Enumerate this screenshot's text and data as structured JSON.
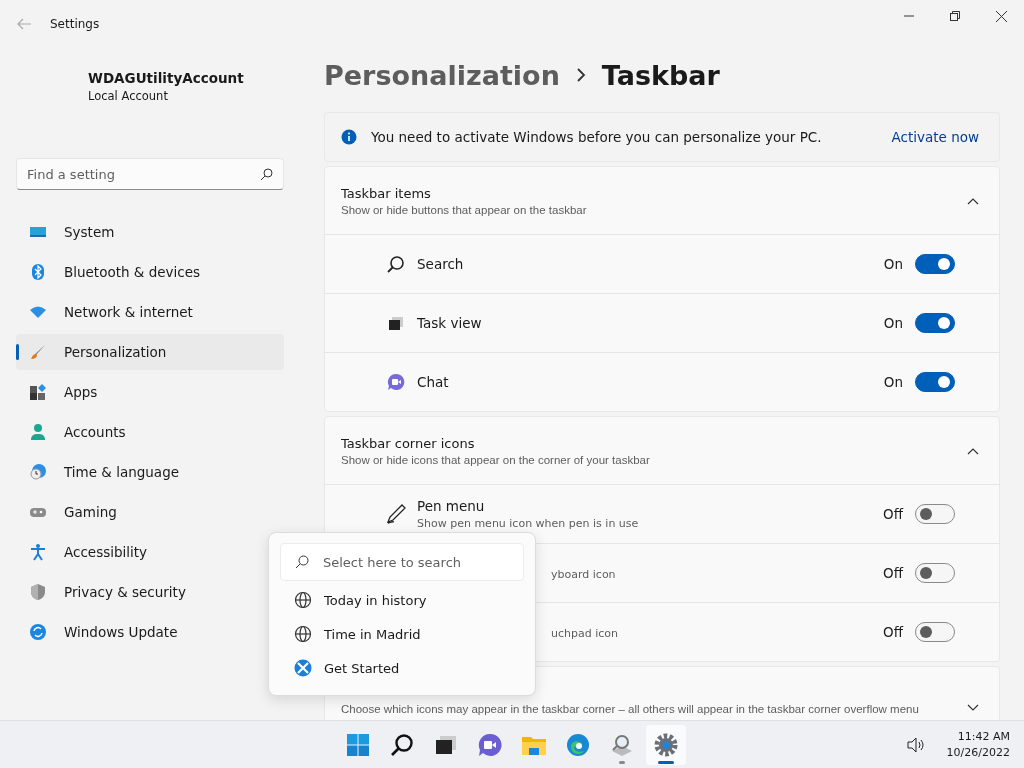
{
  "window": {
    "title": "Settings"
  },
  "account": {
    "name": "WDAGUtilityAccount",
    "type": "Local Account"
  },
  "search": {
    "placeholder": "Find a setting"
  },
  "nav": [
    {
      "label": "System",
      "selected": false
    },
    {
      "label": "Bluetooth & devices",
      "selected": false
    },
    {
      "label": "Network & internet",
      "selected": false
    },
    {
      "label": "Personalization",
      "selected": true
    },
    {
      "label": "Apps",
      "selected": false
    },
    {
      "label": "Accounts",
      "selected": false
    },
    {
      "label": "Time & language",
      "selected": false
    },
    {
      "label": "Gaming",
      "selected": false
    },
    {
      "label": "Accessibility",
      "selected": false
    },
    {
      "label": "Privacy & security",
      "selected": false
    },
    {
      "label": "Windows Update",
      "selected": false
    }
  ],
  "breadcrumb": [
    "Personalization",
    "Taskbar"
  ],
  "banner": {
    "text": "You need to activate Windows before you can personalize your PC.",
    "link": "Activate now"
  },
  "sections": [
    {
      "title": "Taskbar items",
      "subtitle": "Show or hide buttons that appear on the taskbar",
      "expanded": true,
      "rows": [
        {
          "label": "Search",
          "state_text": "On",
          "on": true
        },
        {
          "label": "Task view",
          "state_text": "On",
          "on": true
        },
        {
          "label": "Chat",
          "state_text": "On",
          "on": true
        }
      ]
    },
    {
      "title": "Taskbar corner icons",
      "subtitle": "Show or hide icons that appear on the corner of your taskbar",
      "expanded": true,
      "rows": [
        {
          "label": "Pen menu",
          "description": "Show pen menu icon when pen is in use",
          "state_text": "Off",
          "on": false
        },
        {
          "description": "yboard icon",
          "state_text": "Off",
          "on": false
        },
        {
          "description": "uchpad icon",
          "state_text": "Off",
          "on": false
        }
      ]
    },
    {
      "subtitle": "Choose which icons may appear in the taskbar corner – all others will appear in the taskbar corner overflow menu",
      "expanded": false
    }
  ],
  "popup": {
    "placeholder": "Select here to search",
    "items": [
      "Today in history",
      "Time in Madrid",
      "Get Started"
    ]
  },
  "taskbar": {
    "apps": [
      {
        "selected": false,
        "running": false
      },
      {
        "selected": false,
        "running": false
      },
      {
        "selected": false,
        "running": false
      },
      {
        "selected": false,
        "running": false
      },
      {
        "selected": false,
        "running": false
      },
      {
        "selected": false,
        "running": false
      },
      {
        "selected": false,
        "running": true
      },
      {
        "selected": true,
        "running": true
      }
    ],
    "time": "11:42 AM",
    "date": "10/26/2022"
  }
}
